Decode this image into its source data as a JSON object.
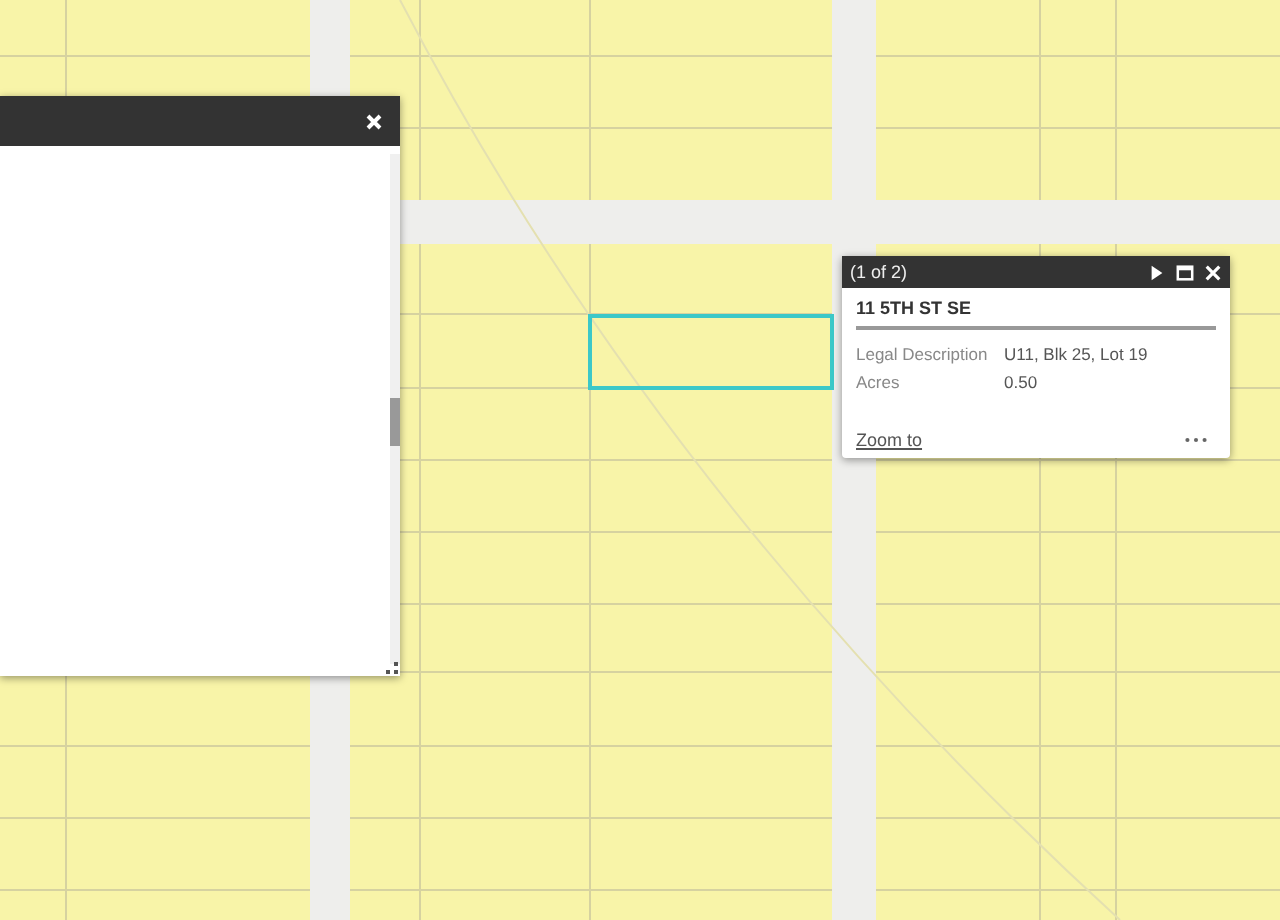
{
  "popup": {
    "counter": "(1 of 2)",
    "title": "11 5TH ST SE",
    "fields": [
      {
        "label": "Legal Description",
        "value": "U11, Blk 25, Lot 19"
      },
      {
        "label": "Acres",
        "value": "0.50"
      }
    ],
    "link": "Zoom to"
  }
}
